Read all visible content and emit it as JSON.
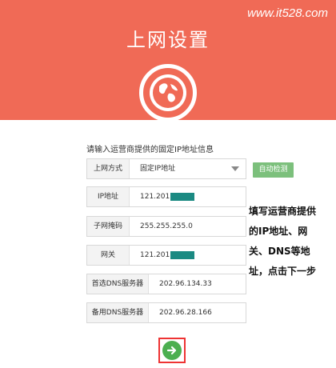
{
  "header": {
    "watermark": "www.it528.com",
    "title": "上网设置",
    "icon": "globe-icon",
    "bg_color": "#f06a56"
  },
  "form": {
    "intro": "请输入运营商提供的固定IP地址信息",
    "connection_type": {
      "label": "上网方式",
      "value": "固定IP地址"
    },
    "auto_detect_label": "自动检测",
    "ip": {
      "label": "IP地址",
      "value": "121.201"
    },
    "subnet": {
      "label": "子网掩码",
      "value": "255.255.255.0"
    },
    "gateway": {
      "label": "网关",
      "value": "121.201"
    },
    "dns1": {
      "label": "首选DNS服务器",
      "value": "202.96.134.33"
    },
    "dns2": {
      "label": "备用DNS服务器",
      "value": "202.96.28.166"
    }
  },
  "annotation": [
    "填写运营商提供",
    "的IP地址、网",
    "关、DNS等地",
    "址，点击下一步"
  ],
  "next_button": {
    "icon": "arrow-right-icon"
  }
}
